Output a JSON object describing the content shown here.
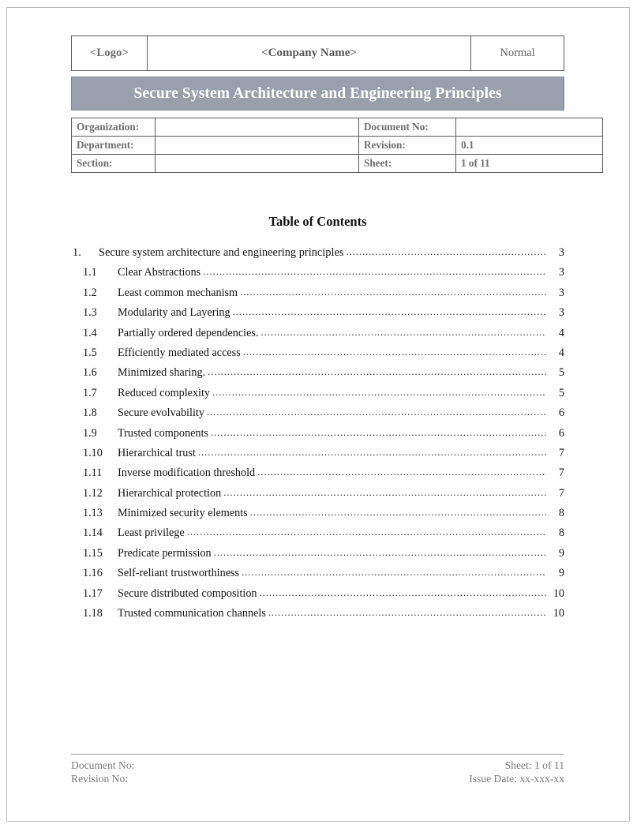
{
  "header_table": {
    "logo": "<Logo>",
    "company_name": "<Company Name>",
    "classification": "Normal"
  },
  "title_banner": {
    "title": "Secure System Architecture and Engineering Principles",
    "background_color": "#99a0ab",
    "text_color": "#ffffff"
  },
  "meta_table": {
    "rows": [
      {
        "label_left": "Organization:",
        "value_left": "",
        "label_right": "Document No:",
        "value_right": ""
      },
      {
        "label_left": "Department:",
        "value_left": "",
        "label_right": "Revision:",
        "value_right": "0.1"
      },
      {
        "label_left": "Section:",
        "value_left": "",
        "label_right": "Sheet:",
        "value_right": "1 of 11"
      }
    ]
  },
  "toc": {
    "heading": "Table of Contents",
    "entries": [
      {
        "number": "1.",
        "text": "Secure system architecture and engineering principles",
        "page": "3",
        "level": 1
      },
      {
        "number": "1.1",
        "text": "Clear Abstractions",
        "page": "3",
        "level": 2
      },
      {
        "number": "1.2",
        "text": "Least common mechanism",
        "page": "3",
        "level": 2
      },
      {
        "number": "1.3",
        "text": "Modularity and Layering",
        "page": "3",
        "level": 2
      },
      {
        "number": "1.4",
        "text": "Partially ordered dependencies.",
        "page": "4",
        "level": 2
      },
      {
        "number": "1.5",
        "text": "Efficiently mediated access",
        "page": "4",
        "level": 2
      },
      {
        "number": "1.6",
        "text": "Minimized sharing.",
        "page": "5",
        "level": 2
      },
      {
        "number": "1.7",
        "text": "Reduced complexity",
        "page": "5",
        "level": 2
      },
      {
        "number": "1.8",
        "text": "Secure evolvability",
        "page": "6",
        "level": 2
      },
      {
        "number": "1.9",
        "text": "Trusted components",
        "page": "6",
        "level": 2
      },
      {
        "number": "1.10",
        "text": "Hierarchical trust",
        "page": "7",
        "level": 2
      },
      {
        "number": "1.11",
        "text": "Inverse modification threshold",
        "page": "7",
        "level": 2
      },
      {
        "number": "1.12",
        "text": "Hierarchical protection",
        "page": "7",
        "level": 2
      },
      {
        "number": "1.13",
        "text": "Minimized security elements",
        "page": "8",
        "level": 2
      },
      {
        "number": "1.14",
        "text": "Least privilege",
        "page": "8",
        "level": 2
      },
      {
        "number": "1.15",
        "text": "Predicate permission",
        "page": "9",
        "level": 2
      },
      {
        "number": "1.16",
        "text": "Self-reliant trustworthiness",
        "page": "9",
        "level": 2
      },
      {
        "number": "1.17",
        "text": "Secure distributed composition",
        "page": "10",
        "level": 2
      },
      {
        "number": "1.18",
        "text": "Trusted communication channels",
        "page": "10",
        "level": 2
      }
    ]
  },
  "footer": {
    "document_no": "Document No:",
    "revision_no": "Revision No:",
    "sheet": "Sheet: 1 of 11",
    "issue_date": "Issue Date: xx-xxx-xx"
  }
}
